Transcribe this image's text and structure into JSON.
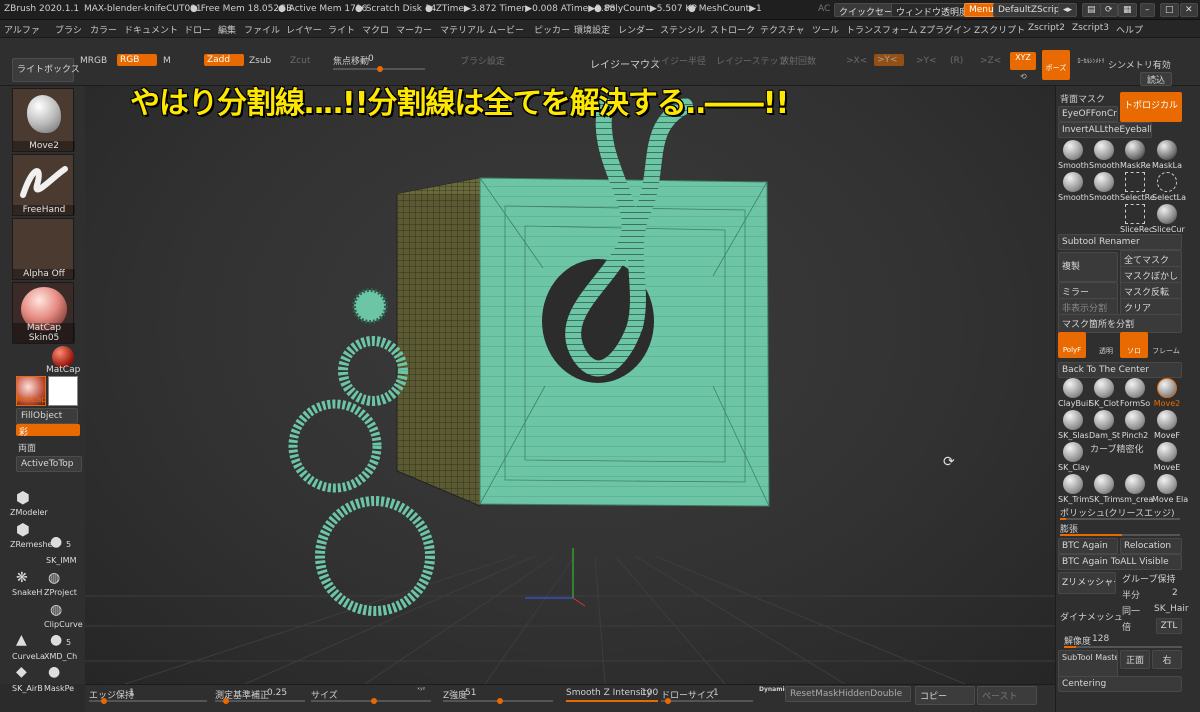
{
  "titlebar": {
    "app": "ZBrush 2020.1.1",
    "doc": "MAX-blender-knifeCUT001",
    "free_mem": "● Free Mem 18.052GB",
    "active_mem": "● Active Mem 1716",
    "scratch": "● Scratch Disk 14",
    "ztime": "● ZTime▶3.872 Timer▶0.008 ATime▶3.88",
    "polycount": "● PolyCount▶5.507 KP",
    "meshcount": "● MeshCount▶1",
    "ac": "AC",
    "quicksave": "クイックセーブ",
    "transparency": "ウィンドウ透明度",
    "menus": "Menus",
    "zscript": "DefaultZScript"
  },
  "menubar": [
    "アルファ",
    "ブラシ",
    "カラー",
    "ドキュメント",
    "ドロー",
    "編集",
    "ファイル",
    "レイヤー",
    "ライト",
    "マクロ",
    "マーカー",
    "マテリアル",
    "ムービー",
    "ピッカー",
    "環境設定",
    "レンダー",
    "ステンシル",
    "ストローク",
    "テクスチャ",
    "ツール",
    "トランスフォーム",
    "Zプラグイン",
    "Zスクリプト",
    "Zscript2",
    "Zscript3",
    "ヘルプ"
  ],
  "shelf": {
    "mrgb": "MRGB",
    "rgb": "RGB",
    "m": "M",
    "zadd": "Zadd",
    "zsub": "Zsub",
    "zcut": "Zcut",
    "focal_label": "焦点移動",
    "focal_value": "0",
    "brush_settings": "ブラシ設定",
    "lazy_mouse": "レイジーマウス",
    "lazy_radius": "レイジー半径",
    "lazy_step": "レイジーステップ",
    "throw_count": "放射回数",
    "x_axis": ">X<",
    "y_axis": ">Y<",
    "r": "(R)",
    "z_axis": ">Z<",
    "xyz": "XYZ",
    "symmetry": "シンメトリ有効",
    "load": "読込",
    "pose_label": "ポーズ",
    "locsym_label": "ﾛｰｶﾙｼﾝﾒﾄﾘ"
  },
  "overlay_title": "やはり分割線‥‥!!分割線は全てを解決する‥――!!",
  "left": {
    "lightbox": "ライトボックス",
    "brush_name": "Move2",
    "stroke_name": "FreeHand",
    "alpha_name": "Alpha Off",
    "material_name": "MatCap Skin05",
    "matcap": "MatCap",
    "matcap_small": "MatCap",
    "fillobject": "FillObject",
    "color_btn": "彩",
    "both_sides": "両面",
    "active_to_top": "ActiveToTop",
    "tools": [
      {
        "label": "ZModeler"
      },
      {
        "label": "ZRemesher"
      },
      {
        "label": "SK_IMM"
      },
      {
        "label": "SnakeH"
      },
      {
        "label": "ZProject"
      },
      {
        "label": "ClipCurve"
      },
      {
        "label": "CurveLa"
      },
      {
        "label": "XMD_Ch"
      },
      {
        "label": "SK_AirB"
      },
      {
        "label": "MaskPe"
      }
    ],
    "num5a": "5",
    "num5b": "5"
  },
  "right": {
    "back_mask": "背面マスク",
    "topological": "トポロジカル",
    "eye_off": "EyeOFFonCrsr",
    "invert_eyes": "InvertALLtheEyeballs",
    "brushes_row1": [
      "Smooth",
      "Smooth",
      "MaskRe",
      "MaskLa"
    ],
    "brushes_row2": [
      "Smooth",
      "Smooth",
      "SelectRe",
      "SelectLa"
    ],
    "brushes_row3": [
      "SliceRec",
      "SliceCur"
    ],
    "subtool_renamer": "Subtool Renamer",
    "duplicate": "複製",
    "mask_all": "全てマスク",
    "mask_blur": "マスクぼかし",
    "mirror": "ミラー",
    "mask_invert": "マスク反転",
    "hide_unmasked": "非表示分割",
    "clear": "クリア",
    "split_mask": "マスク箇所を分割",
    "polyf": "PolyF",
    "transparent": "透明",
    "solo": "ソロ",
    "frame": "フレーム",
    "back_to_center": "Back To The Center",
    "brushes_row4": [
      "ClayBuil",
      "SK_Clot",
      "FormSo",
      "Move2"
    ],
    "brushes_row5": [
      "SK_Slas",
      "Dam_St",
      "Pinch2",
      "MoveF"
    ],
    "brushes_row6": [
      "SK_Clay",
      "カーブ精密化",
      "MoveE"
    ],
    "brushes_row7": [
      "SK_Trim",
      "SK_Trim",
      "sm_crea",
      "Move Ela"
    ],
    "polish": "ポリッシュ(クリースエッジ)",
    "inflate": "膨張",
    "btc_again": "BTC Again",
    "relocation": "Relocation",
    "btc_all": "BTC Again ToALL Visible",
    "zremesher": "Zリメッシャー",
    "group_keep": "グループ保持",
    "half": "半分",
    "same": "同一",
    "double": "倍",
    "dynamesh": "ダイナメッシュ",
    "sk_hair": "SK_Hair",
    "ztl": "ZTL",
    "resolution_label": "解像度",
    "resolution_value": "128",
    "subtool_master": "SubTool Master",
    "front": "正面",
    "right_view": "右",
    "centering": "Centering",
    "num2": "2"
  },
  "bottom": {
    "edge_keep_label": "エッジ保持",
    "edge_keep_value": "1",
    "measure_label": "測定基準補正",
    "measure_value": "0.25",
    "size_label": "サイズ",
    "zstrength_label": "Z強度",
    "zstrength_value": "51",
    "smoothz_label": "Smooth Z Intensity",
    "smoothz_value": "100",
    "drawsize_label": "ドローサイズ",
    "drawsize_value": "1",
    "dynamic": "Dynamic",
    "reset_mask": "ResetMaskHiddenDouble",
    "copy": "コピー",
    "paste": "ペースト"
  },
  "colors": {
    "accent": "#e86a00",
    "mesh": "#6cc6a6",
    "overlay_text": "#ffe800"
  }
}
